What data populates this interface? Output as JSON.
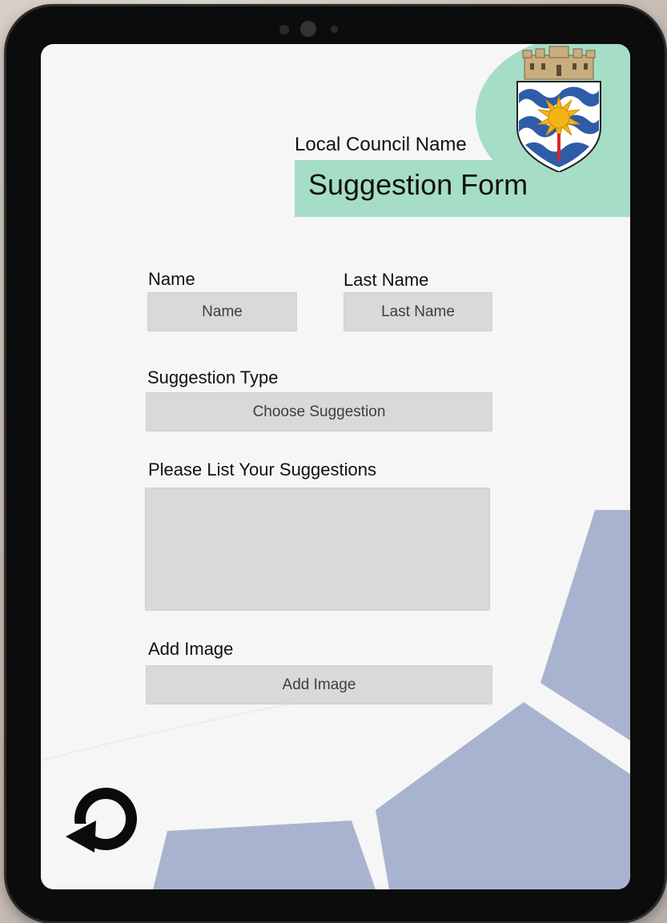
{
  "header": {
    "council_name": "Local Council Name",
    "form_title": "Suggestion Form"
  },
  "form": {
    "name_label": "Name",
    "name_placeholder": "Name",
    "last_name_label": "Last Name",
    "last_name_placeholder": "Last Name",
    "suggestion_type_label": "Suggestion Type",
    "suggestion_type_value": "Choose Suggestion",
    "suggestions_label": "Please List Your Suggestions",
    "suggestions_value": "",
    "add_image_label": "Add Image",
    "add_image_button": "Add Image"
  },
  "icons": {
    "crest": "council-crest-icon",
    "back": "back-arrow-icon"
  },
  "colors": {
    "accent_mint": "#a6ddc6",
    "field_gray": "#d9d9d9",
    "shape_blue": "#a8b4cf",
    "screen_bg": "#f6f6f6"
  }
}
